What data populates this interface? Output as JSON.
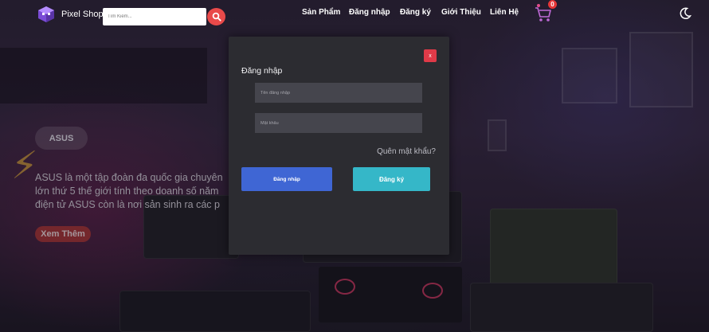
{
  "brand": {
    "name": "Pixel Shop",
    "logo_icon": "cube-logo-icon"
  },
  "search": {
    "placeholder": "Tìm Kiếm...",
    "value": "",
    "icon": "search-icon"
  },
  "nav": {
    "items": [
      {
        "label": "Sản Phẩm"
      },
      {
        "label": "Đăng nhập"
      },
      {
        "label": "Đăng ký"
      },
      {
        "label": "Giới Thiệu"
      },
      {
        "label": "Liên Hệ"
      }
    ],
    "cart_count": "0",
    "cart_icon": "shopping-cart-icon",
    "theme_icon": "moon-icon"
  },
  "hero": {
    "badge": "ASUS",
    "lines": [
      "ASUS là một tập đoàn đa quốc gia chuyên",
      "lớn thứ 5 thế giới tính theo doanh số năm",
      "điện tử ASUS còn là nơi sản sinh ra các p"
    ],
    "button": "Xem Thêm"
  },
  "modal": {
    "close_label": "x",
    "title": "Đăng nhập",
    "username_placeholder": "Tên đăng nhập",
    "password_placeholder": "Mật khẩu",
    "forgot": "Quên mật khẩu?",
    "login_button": "Đăng nhập",
    "register_button": "Đăng ký"
  },
  "colors": {
    "accent_red": "#e94a4a",
    "login_blue": "#3f66d4",
    "register_cyan": "#35b7c8",
    "modal_bg": "#2c2c31"
  }
}
